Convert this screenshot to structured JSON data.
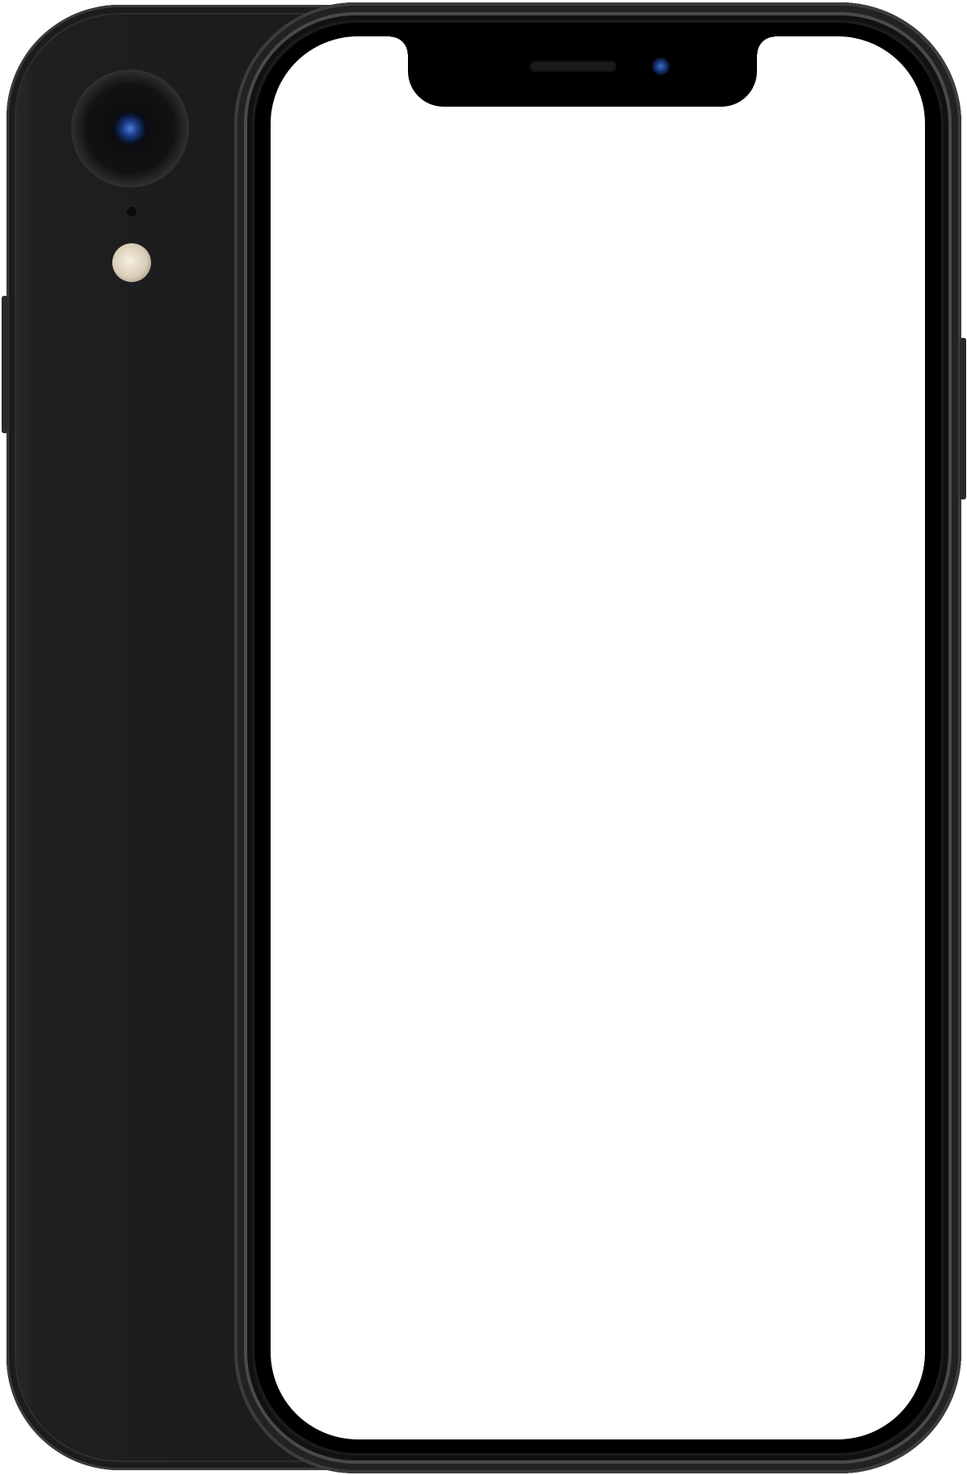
{
  "device": {
    "model_finish": "black",
    "colors": {
      "body": "#1c1c1e",
      "frame": "#3a3a3c",
      "bezel": "#000000",
      "screen": "#ffffff",
      "lens": "#1b3e88",
      "flash": "#e8dfcf"
    },
    "icons": {
      "rear_camera": "camera-lens-icon",
      "flash": "flash-icon",
      "front_camera": "front-camera-icon",
      "speaker": "earpiece-speaker-icon"
    }
  }
}
